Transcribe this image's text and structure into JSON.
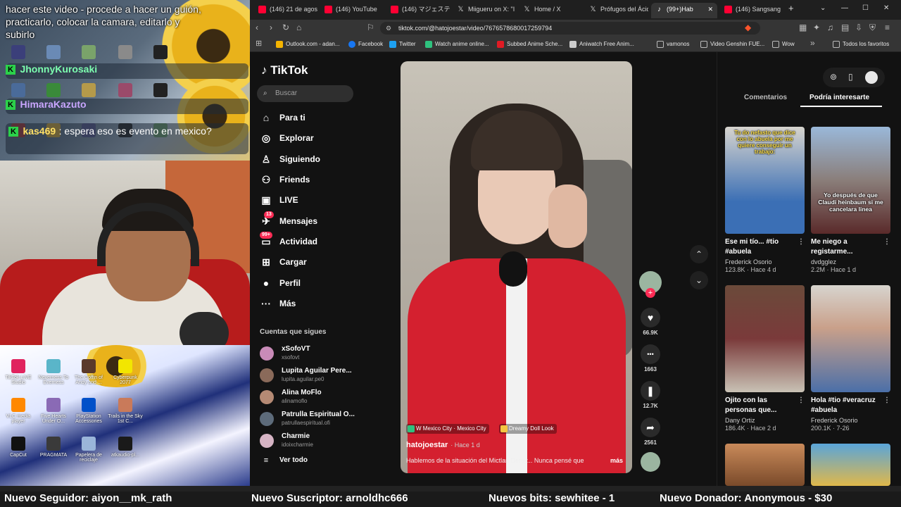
{
  "overlay": {
    "chat": [
      {
        "user": "",
        "text": "hacer este video - procede a hacer un guión, practicarlo, colocar la camara, editarlo y subirlo"
      },
      {
        "user": "JhonnyKurosaki",
        "text": ""
      },
      {
        "user": "HimaraKazuto",
        "text": ""
      },
      {
        "user": "kas469",
        "text": ": espera eso es evento en mexico?"
      }
    ],
    "desktop_icons": [
      "TikTok LIVE Studio",
      "Neverness To Everness",
      "The Coffin of Andy and ...",
      "Cyberpunk 2077",
      "VLC media player",
      "Five Hearts Under O...",
      "PlayStation Accessories",
      "Trails in the Sky 1st C...",
      "CapCut",
      "PRAGMATA",
      "Papelera de reciclaje",
      "atkaudio-pl..."
    ]
  },
  "browser": {
    "tabs": [
      {
        "label": "(146) 21 de agost",
        "icon": "youtube-icon",
        "color": "#ff0033"
      },
      {
        "label": "(146) YouTube",
        "icon": "youtube-icon",
        "color": "#ff0033"
      },
      {
        "label": "(146) マジェスティ",
        "icon": "youtube-icon",
        "color": "#ff0033"
      },
      {
        "label": "Miigueru on X: \"I",
        "icon": "x-icon",
        "color": "#ffffff"
      },
      {
        "label": "Home / X",
        "icon": "x-icon",
        "color": "#ffffff"
      },
      {
        "label": "Prófugos del Ácid",
        "icon": "x-icon",
        "color": "#ffffff"
      },
      {
        "label": "(99+)Hab",
        "icon": "tiktok-icon",
        "color": "#ffffff"
      },
      {
        "label": "(146) Sangsang",
        "icon": "youtube-icon",
        "color": "#ff0033"
      }
    ],
    "url": "tiktok.com/@hatojoestar/video/7676578680017259794",
    "bookmarks": [
      {
        "label": "Outlook.com - adan...",
        "color": "#f4b400"
      },
      {
        "label": "Facebook",
        "color": "#1877f2"
      },
      {
        "label": "Twitter",
        "color": "#1da1f2"
      },
      {
        "label": "Watch anime online...",
        "color": "#2ec27e"
      },
      {
        "label": "Subbed Anime Sche...",
        "color": "#e01b24"
      },
      {
        "label": "Aniwatch Free Anim...",
        "color": "#cccccc"
      },
      {
        "label": "vamonos",
        "color": "#aaaaaa"
      },
      {
        "label": "Video Genshin FUE...",
        "color": "#aaaaaa"
      },
      {
        "label": "Wow",
        "color": "#aaaaaa"
      },
      {
        "label": "Todos los favoritos",
        "color": "#aaaaaa"
      }
    ]
  },
  "tiktok": {
    "logo": "TikTok",
    "search_placeholder": "Buscar",
    "nav": [
      {
        "label": "Para ti",
        "icon": "home-icon",
        "glyph": "⌂"
      },
      {
        "label": "Explorar",
        "icon": "compass-icon",
        "glyph": "◎"
      },
      {
        "label": "Siguiendo",
        "icon": "following-icon",
        "glyph": "♙"
      },
      {
        "label": "Friends",
        "icon": "friends-icon",
        "glyph": "⚇"
      },
      {
        "label": "LIVE",
        "icon": "live-icon",
        "glyph": "▣"
      },
      {
        "label": "Mensajes",
        "icon": "messages-icon",
        "glyph": "✈",
        "badge": "13"
      },
      {
        "label": "Actividad",
        "icon": "activity-icon",
        "glyph": "▭",
        "badge": "99+"
      },
      {
        "label": "Cargar",
        "icon": "upload-icon",
        "glyph": "⊞"
      },
      {
        "label": "Perfil",
        "icon": "profile-icon",
        "glyph": "●"
      },
      {
        "label": "Más",
        "icon": "more-icon",
        "glyph": "···"
      }
    ],
    "following_title": "Cuentas que sigues",
    "following": [
      {
        "name": "xSofoVT",
        "user": "xsofovt",
        "color": "#c98bb8"
      },
      {
        "name": "Lupita Aguilar Pere...",
        "user": "lupita.aguilar.pe0",
        "color": "#8a6a5a"
      },
      {
        "name": "Alina MoFlo",
        "user": "alinamoflo",
        "color": "#b58a74"
      },
      {
        "name": "Patrulla Espiritual O...",
        "user": "patrullaespiritual.ofi",
        "color": "#5d6b7a"
      },
      {
        "name": "Charmie",
        "user": "idoixcharmie",
        "color": "#d6b4c4"
      }
    ],
    "see_all": "Ver todo",
    "video": {
      "location": "W Mexico City · Mexico City",
      "effect": "Dreamy Doll Look",
      "author": "hatojoestar",
      "time": "· Hace 1 d",
      "description": "Hablemos de la situación del Mictlan Derby... Nunca pensé que",
      "more": "más"
    },
    "actions": [
      {
        "icon": "heart-icon",
        "glyph": "♥",
        "count": "66.9K"
      },
      {
        "icon": "comment-icon",
        "glyph": "•••",
        "count": "1663"
      },
      {
        "icon": "bookmark-icon",
        "glyph": "❚",
        "count": "12.7K"
      },
      {
        "icon": "share-icon",
        "glyph": "➦",
        "count": "2561"
      }
    ],
    "right_tabs": [
      "Comentarios",
      "Podría interesarte"
    ],
    "recommended": [
      {
        "title": "Ese mi tío... #tio #abuela",
        "author": "Frederick Osorio",
        "stats": "123.8K · Hace 4 d",
        "caption": "Tu do nefasto que dice con lo abuela por me quiere conseguir un trabajo:",
        "color": "#3b6fb5"
      },
      {
        "title": "Me niego a registarme...",
        "author": "dvdgglez",
        "stats": "2.2M · Hace 1 d",
        "caption": "Yo después de que Claudi heinbaum si me cancelara linea",
        "color": "#8a7e7a"
      },
      {
        "title": "Ojito con las personas que...",
        "author": "Dany Ortiz",
        "stats": "186.4K · Hace 2 d",
        "caption": "",
        "color": "#7a3a3a"
      },
      {
        "title": "Hola #tio #veracruz #abuela",
        "author": "Frederick Osorio",
        "stats": "200.1K · 7-26",
        "caption": "",
        "color": "#4b6fa8"
      }
    ]
  },
  "ticker": [
    "Nuevo Seguidor: aiyon__mk_rath",
    "Nuevo Suscriptor: arnoldhc666",
    "Nuevos bits: sewhitee - 1",
    "Nuevo Donador: Anonymous - $30"
  ]
}
